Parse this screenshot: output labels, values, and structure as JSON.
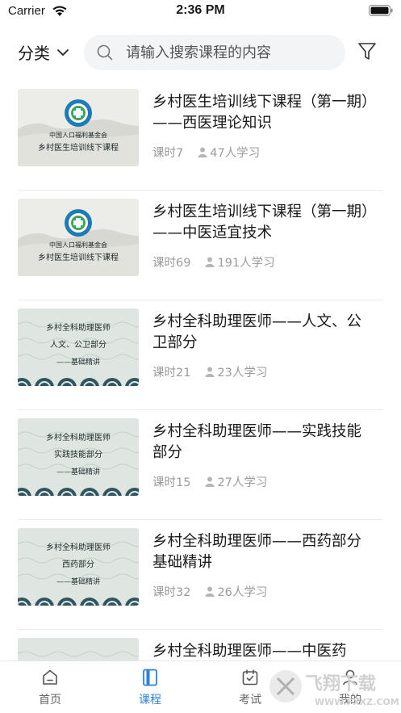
{
  "status_bar": {
    "carrier": "Carrier",
    "time": "2:36 PM"
  },
  "header": {
    "category_label": "分类",
    "search_placeholder": "请输入搜索课程的内容"
  },
  "courses": [
    {
      "title": "乡村医生培训线下课程（第一期）——西医理论知识",
      "lessons": "课时7",
      "learners": "47人学习",
      "thumb_lines": [
        "中国人口福利基金会",
        "乡村医生培训线下课程"
      ]
    },
    {
      "title": "乡村医生培训线下课程（第一期）——中医适宜技术",
      "lessons": "课时69",
      "learners": "191人学习",
      "thumb_lines": [
        "中国人口福利基金会",
        "乡村医生培训线下课程"
      ]
    },
    {
      "title": "乡村全科助理医师——人文、公卫部分",
      "lessons": "课时21",
      "learners": "23人学习",
      "thumb_lines": [
        "乡村全科助理医师",
        "人文、公卫部分",
        "——基础精讲"
      ]
    },
    {
      "title": "乡村全科助理医师——实践技能部分",
      "lessons": "课时15",
      "learners": "27人学习",
      "thumb_lines": [
        "乡村全科助理医师",
        "实践技能部分",
        "——基础精讲"
      ]
    },
    {
      "title": "乡村全科助理医师——西药部分基础精讲",
      "lessons": "课时32",
      "learners": "26人学习",
      "thumb_lines": [
        "乡村全科助理医师",
        "西药部分",
        "——基础精讲"
      ]
    },
    {
      "title": "乡村全科助理医师——中医药",
      "lessons": "",
      "learners": "",
      "thumb_lines": []
    }
  ],
  "tabbar": {
    "tabs": [
      {
        "label": "首页",
        "icon": "home-icon",
        "active": false
      },
      {
        "label": "课程",
        "icon": "book-icon",
        "active": true
      },
      {
        "label": "考试",
        "icon": "calendar-check-icon",
        "active": false
      },
      {
        "label": "我的",
        "icon": "user-icon",
        "active": false
      }
    ]
  },
  "watermark": {
    "text": "飞翔下载",
    "url": "WWW.FXXZ.COM"
  },
  "colors": {
    "accent": "#2c82d8",
    "muted": "#9b9b9b",
    "search_bg": "#f3f4f6"
  }
}
